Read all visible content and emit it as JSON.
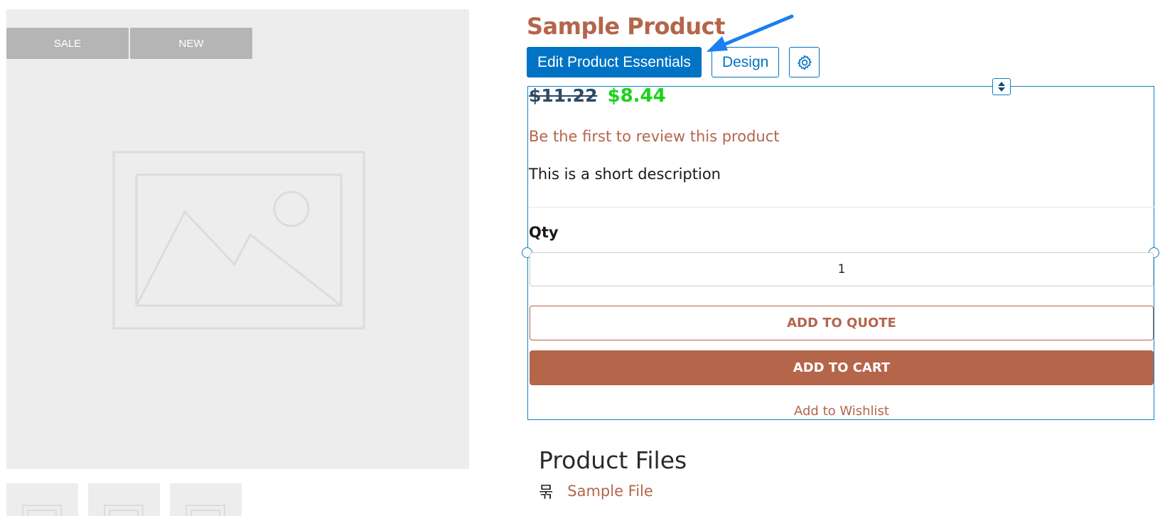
{
  "gallery": {
    "badges": [
      "SALE",
      "NEW"
    ],
    "main_image_icon": "image-placeholder-icon",
    "thumbnail_count": 3
  },
  "product": {
    "title": "Sample Product",
    "price_old": "$11.22",
    "price_new": "$8.44",
    "review_link": "Be the first to review this product",
    "short_description": "This is a short description",
    "qty_label": "Qty",
    "qty_value": "1"
  },
  "editor_toolbar": {
    "edit_label": "Edit Product Essentials",
    "design_label": "Design",
    "settings_icon": "gear-icon"
  },
  "actions": {
    "add_to_quote": "ADD TO QUOTE",
    "add_to_cart": "ADD TO CART",
    "wishlist": "Add to Wishlist"
  },
  "files": {
    "title": "Product Files",
    "items": [
      {
        "icon": "file-archive-icon",
        "name": "Sample File"
      }
    ]
  },
  "colors": {
    "accent": "#b4654a",
    "editor_blue": "#0073c4",
    "sale_price": "#1bd31b",
    "old_price": "#2e4a63",
    "badge": "#b5b5b5",
    "placeholder_bg": "#ededed"
  }
}
